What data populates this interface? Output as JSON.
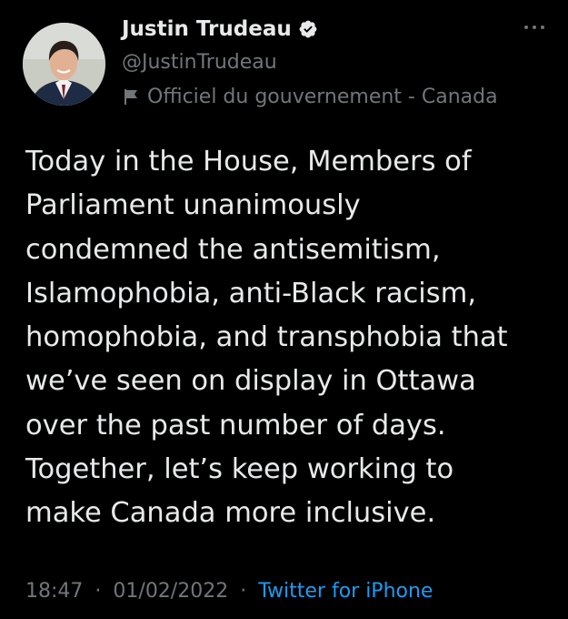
{
  "author": {
    "display_name": "Justin Trudeau",
    "handle": "@JustinTrudeau",
    "verified": true,
    "affiliation_label": "Officiel du gouvernement - Canada"
  },
  "tweet": {
    "text": "Today in the House, Members of\nParliament unanimously\ncondemned the antisemitism,\nIslamophobia, anti-Black racism,\nhomophobia, and transphobia that\nwe’ve seen on display in Ottawa\nover the past number of days.\nTogether, let’s keep working to\nmake Canada more inclusive.",
    "time": "18:47",
    "date": "01/02/2022",
    "separator": "·",
    "source": "Twitter for iPhone"
  },
  "icons": {
    "verified": "verified-badge-icon",
    "label": "government-flag-icon",
    "more": "more-options-icon"
  },
  "colors": {
    "background": "#000000",
    "primary_text": "#e7e9ea",
    "secondary_text": "#71767b",
    "link": "#1d9bf0"
  }
}
